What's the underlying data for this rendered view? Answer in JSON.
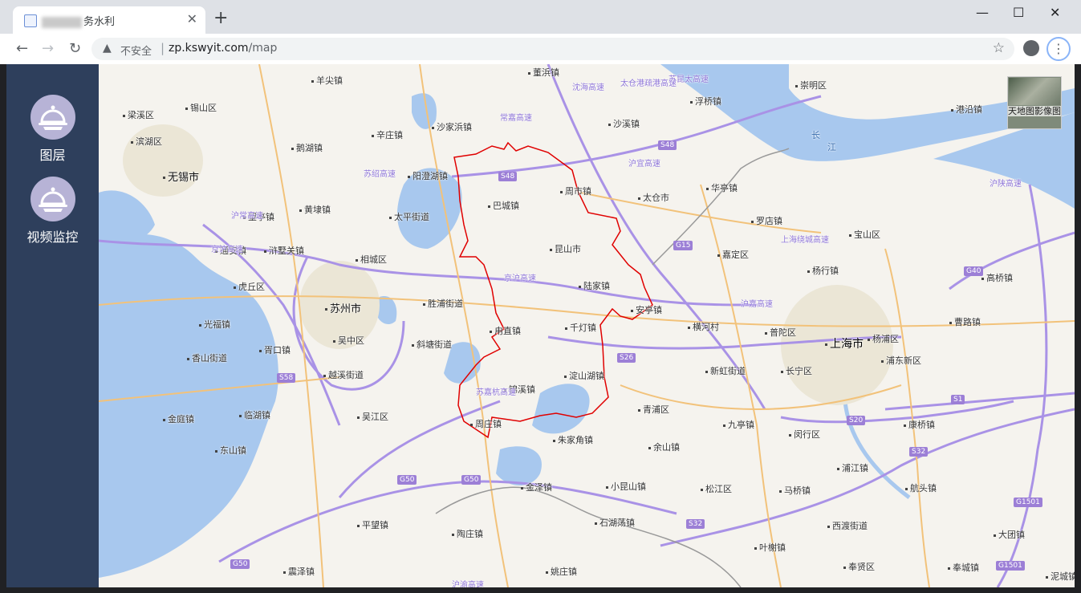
{
  "browser": {
    "tab_title_suffix": "务水利",
    "tab_close": "✕",
    "new_tab": "+",
    "win_min": "—",
    "win_max": "☐",
    "win_close": "✕",
    "back": "←",
    "forward": "→",
    "reload": "↻",
    "insecure_label": "不安全",
    "url_host": "zp.kswyit.com",
    "url_path": "/map",
    "star": "☆",
    "menu": "⋮"
  },
  "sidebar": {
    "items": [
      {
        "label": "图层",
        "icon": "layers-cloche-icon"
      },
      {
        "label": "视频监控",
        "icon": "video-monitor-cloche-icon"
      }
    ]
  },
  "map": {
    "basemap_switch_label": "天地图影像图",
    "colors": {
      "water": "#a8c8ee",
      "land": "#f5f3ee",
      "highway": "#a992e6",
      "road": "#f2c27a",
      "boundary": "#e00000"
    },
    "places": [
      {
        "name": "羊尖镇",
        "size": "normal"
      },
      {
        "name": "董浜镇",
        "size": "normal"
      },
      {
        "name": "崇明区",
        "size": "normal"
      },
      {
        "name": "锡山区",
        "size": "normal"
      },
      {
        "name": "梁溪区",
        "size": "normal"
      },
      {
        "name": "滨湖区",
        "size": "normal"
      },
      {
        "name": "沙家浜镇",
        "size": "normal"
      },
      {
        "name": "辛庄镇",
        "size": "normal"
      },
      {
        "name": "沙溪镇",
        "size": "normal"
      },
      {
        "name": "浮桥镇",
        "size": "normal"
      },
      {
        "name": "港沿镇",
        "size": "normal"
      },
      {
        "name": "鹅湖镇",
        "size": "normal"
      },
      {
        "name": "无锡市",
        "size": "big"
      },
      {
        "name": "阳澄湖镇",
        "size": "normal"
      },
      {
        "name": "周市镇",
        "size": "normal"
      },
      {
        "name": "太仓市",
        "size": "normal"
      },
      {
        "name": "华亭镇",
        "size": "normal"
      },
      {
        "name": "巴城镇",
        "size": "normal"
      },
      {
        "name": "黄埭镇",
        "size": "normal"
      },
      {
        "name": "望亭镇",
        "size": "normal"
      },
      {
        "name": "太平街道",
        "size": "normal"
      },
      {
        "name": "罗店镇",
        "size": "normal"
      },
      {
        "name": "宝山区",
        "size": "normal"
      },
      {
        "name": "昆山市",
        "size": "normal"
      },
      {
        "name": "通安镇",
        "size": "normal"
      },
      {
        "name": "浒墅关镇",
        "size": "normal"
      },
      {
        "name": "相城区",
        "size": "normal"
      },
      {
        "name": "嘉定区",
        "size": "normal"
      },
      {
        "name": "杨行镇",
        "size": "normal"
      },
      {
        "name": "高桥镇",
        "size": "normal"
      },
      {
        "name": "陆家镇",
        "size": "normal"
      },
      {
        "name": "虎丘区",
        "size": "normal"
      },
      {
        "name": "苏州市",
        "size": "big"
      },
      {
        "name": "胜浦街道",
        "size": "normal"
      },
      {
        "name": "安亭镇",
        "size": "normal"
      },
      {
        "name": "光福镇",
        "size": "normal"
      },
      {
        "name": "横河村",
        "size": "normal"
      },
      {
        "name": "曹路镇",
        "size": "normal"
      },
      {
        "name": "吴中区",
        "size": "normal"
      },
      {
        "name": "甪直镇",
        "size": "normal"
      },
      {
        "name": "千灯镇",
        "size": "normal"
      },
      {
        "name": "普陀区",
        "size": "normal"
      },
      {
        "name": "杨浦区",
        "size": "normal"
      },
      {
        "name": "上海市",
        "size": "huge"
      },
      {
        "name": "香山街道",
        "size": "normal"
      },
      {
        "name": "胥口镇",
        "size": "normal"
      },
      {
        "name": "斜塘街道",
        "size": "normal"
      },
      {
        "name": "浦东新区",
        "size": "normal"
      },
      {
        "name": "越溪街道",
        "size": "normal"
      },
      {
        "name": "新虹街道",
        "size": "normal"
      },
      {
        "name": "长宁区",
        "size": "normal"
      },
      {
        "name": "淀山湖镇",
        "size": "normal"
      },
      {
        "name": "锦溪镇",
        "size": "normal"
      },
      {
        "name": "金庭镇",
        "size": "normal"
      },
      {
        "name": "临湖镇",
        "size": "normal"
      },
      {
        "name": "吴江区",
        "size": "normal"
      },
      {
        "name": "青浦区",
        "size": "normal"
      },
      {
        "name": "周庄镇",
        "size": "normal"
      },
      {
        "name": "九亭镇",
        "size": "normal"
      },
      {
        "name": "闵行区",
        "size": "normal"
      },
      {
        "name": "康桥镇",
        "size": "normal"
      },
      {
        "name": "朱家角镇",
        "size": "normal"
      },
      {
        "name": "东山镇",
        "size": "normal"
      },
      {
        "name": "余山镇",
        "size": "normal"
      },
      {
        "name": "浦江镇",
        "size": "normal"
      },
      {
        "name": "金泽镇",
        "size": "normal"
      },
      {
        "name": "小昆山镇",
        "size": "normal"
      },
      {
        "name": "松江区",
        "size": "normal"
      },
      {
        "name": "马桥镇",
        "size": "normal"
      },
      {
        "name": "航头镇",
        "size": "normal"
      },
      {
        "name": "平望镇",
        "size": "normal"
      },
      {
        "name": "石湖荡镇",
        "size": "normal"
      },
      {
        "name": "西渡街道",
        "size": "normal"
      },
      {
        "name": "大团镇",
        "size": "normal"
      },
      {
        "name": "陶庄镇",
        "size": "normal"
      },
      {
        "name": "叶榭镇",
        "size": "normal"
      },
      {
        "name": "震泽镇",
        "size": "normal"
      },
      {
        "name": "姚庄镇",
        "size": "normal"
      },
      {
        "name": "奉贤区",
        "size": "normal"
      },
      {
        "name": "奉城镇",
        "size": "normal"
      },
      {
        "name": "泥城镇",
        "size": "normal"
      }
    ],
    "water_labels": [
      "长",
      "江"
    ],
    "shields": [
      "S48",
      "S48",
      "G15",
      "S26",
      "G40",
      "S58",
      "G50",
      "G50",
      "S1",
      "S20",
      "S32",
      "S32",
      "G1501",
      "G1501",
      "G50"
    ],
    "expressway_labels": [
      "沈海高速",
      "太仓港疏港高速",
      "苏昆太高速",
      "常嘉高速",
      "沪宜高速",
      "苏绍高速",
      "京沪高速",
      "京沪高速",
      "沪常高速",
      "上海绕城高速",
      "沪嘉高速",
      "沪渝高速",
      "沪陕高速",
      "苏嘉杭高速"
    ]
  }
}
